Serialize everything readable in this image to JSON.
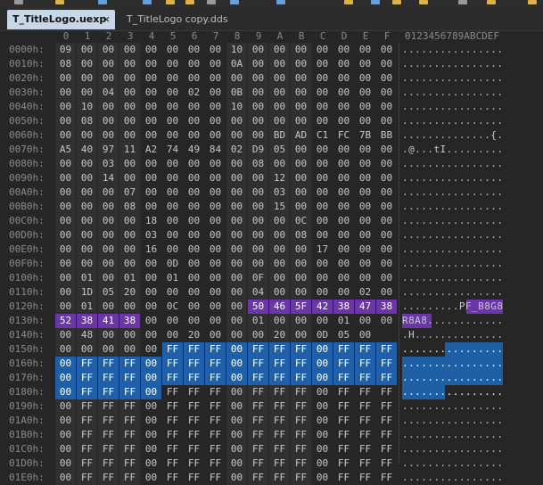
{
  "tabs": [
    {
      "label": "T_TitleLogo.uexp",
      "active": true,
      "close": "×"
    },
    {
      "label": "T_TitleLogo copy.dds",
      "active": false
    }
  ],
  "column_headers": [
    "0",
    "1",
    "2",
    "3",
    "4",
    "5",
    "6",
    "7",
    "8",
    "9",
    "A",
    "B",
    "C",
    "D",
    "E",
    "F"
  ],
  "ascii_header": "0123456789ABCDEF",
  "rows": [
    {
      "offset": "0000h:",
      "bytes": "09 00 00 00 00 00 00 00 10 00 00 00 00 00 00 00",
      "ascii": "................"
    },
    {
      "offset": "0010h:",
      "bytes": "08 00 00 00 00 00 00 00 0A 00 00 00 00 00 00 00",
      "ascii": "................"
    },
    {
      "offset": "0020h:",
      "bytes": "00 00 00 00 00 00 00 00 00 00 00 00 00 00 00 00",
      "ascii": "................"
    },
    {
      "offset": "0030h:",
      "bytes": "00 00 04 00 00 00 02 00 0B 00 00 00 00 00 00 00",
      "ascii": "................"
    },
    {
      "offset": "0040h:",
      "bytes": "00 10 00 00 00 00 00 00 10 00 00 00 00 00 00 00",
      "ascii": "................"
    },
    {
      "offset": "0050h:",
      "bytes": "00 08 00 00 00 00 00 00 00 00 00 00 00 00 00 00",
      "ascii": "................"
    },
    {
      "offset": "0060h:",
      "bytes": "00 00 00 00 00 00 00 00 00 00 BD AD C1 FC 7B BB",
      "ascii": "..............{."
    },
    {
      "offset": "0070h:",
      "bytes": "A5 40 97 11 A2 74 49 84 02 D9 05 00 00 00 00 00",
      "ascii": ".@...tI........."
    },
    {
      "offset": "0080h:",
      "bytes": "00 00 03 00 00 00 00 00 00 08 00 00 00 00 00 00",
      "ascii": "................"
    },
    {
      "offset": "0090h:",
      "bytes": "00 00 14 00 00 00 00 00 00 00 12 00 00 00 00 00",
      "ascii": "................"
    },
    {
      "offset": "00A0h:",
      "bytes": "00 00 00 07 00 00 00 00 00 00 03 00 00 00 00 00",
      "ascii": "................"
    },
    {
      "offset": "00B0h:",
      "bytes": "00 00 00 08 00 00 00 00 00 00 15 00 00 00 00 00",
      "ascii": "................"
    },
    {
      "offset": "00C0h:",
      "bytes": "00 00 00 00 18 00 00 00 00 00 00 0C 00 00 00 00",
      "ascii": "................"
    },
    {
      "offset": "00D0h:",
      "bytes": "00 00 00 00 03 00 00 00 00 00 00 08 00 00 00 00",
      "ascii": "................"
    },
    {
      "offset": "00E0h:",
      "bytes": "00 00 00 00 16 00 00 00 00 00 00 00 17 00 00 00",
      "ascii": "................"
    },
    {
      "offset": "00F0h:",
      "bytes": "00 00 00 00 00 0D 00 00 00 00 00 00 00 00 00 00",
      "ascii": "................"
    },
    {
      "offset": "0100h:",
      "bytes": "00 01 00 01 00 01 00 00 00 0F 00 00 00 00 00 00",
      "ascii": "................"
    },
    {
      "offset": "0110h:",
      "bytes": "00 1D 05 20 00 00 00 00 00 04 00 00 00 00 02 00",
      "ascii": "................"
    },
    {
      "offset": "0120h:",
      "bytes": "00 01 00 00 00 0C 00 00 00 50 46 5F 42 38 47 38",
      "ascii": ".........PF_B8G8"
    },
    {
      "offset": "0130h:",
      "bytes": "52 38 41 38 00 00 00 00 00 01 00 00 00 01 00 00",
      "ascii": "R8A8............"
    },
    {
      "offset": "0140h:",
      "bytes": "00 48 00 00 00 00 20 00 00 00 20 00 0D 05 00",
      "ascii": ".H.............."
    },
    {
      "offset": "0150h:",
      "bytes": "00 00 00 00 00 FF FF FF 00 FF FF FF 00 FF FF FF",
      "ascii": "................"
    },
    {
      "offset": "0160h:",
      "bytes": "00 FF FF FF 00 FF FF FF 00 FF FF FF 00 FF FF FF",
      "ascii": "................"
    },
    {
      "offset": "0170h:",
      "bytes": "00 FF FF FF 00 FF FF FF 00 FF FF FF 00 FF FF FF",
      "ascii": "................"
    },
    {
      "offset": "0180h:",
      "bytes": "00 FF FF FF 00 FF FF FF 00 FF FF FF 00 FF FF FF",
      "ascii": "................"
    },
    {
      "offset": "0190h:",
      "bytes": "00 FF FF FF 00 FF FF FF 00 FF FF FF 00 FF FF FF",
      "ascii": "................"
    },
    {
      "offset": "01A0h:",
      "bytes": "00 FF FF FF 00 FF FF FF 00 FF FF FF 00 FF FF FF",
      "ascii": "................"
    },
    {
      "offset": "01B0h:",
      "bytes": "00 FF FF FF 00 FF FF FF 00 FF FF FF 00 FF FF FF",
      "ascii": "................"
    },
    {
      "offset": "01C0h:",
      "bytes": "00 FF FF FF 00 FF FF FF 00 FF FF FF 00 FF FF FF",
      "ascii": "................"
    },
    {
      "offset": "01D0h:",
      "bytes": "00 FF FF FF 00 FF FF FF 00 FF FF FF 00 FF FF FF",
      "ascii": "................"
    },
    {
      "offset": "01E0h:",
      "bytes": "00 FF FF FF 00 FF FF FF 00 FF FF FF 00 FF FF FF",
      "ascii": "................"
    }
  ],
  "purple_bytes_in_row_18_from": 9,
  "purple_bytes_in_row_19_to": 3,
  "selection_start_row": 21,
  "selection_start_col": 5,
  "selection_end_row": 24,
  "selection_end_col": 5,
  "colors": {
    "selection": "#1e5fa8",
    "highlight": "#6a36a8",
    "active_tab": "#c7d7e8"
  }
}
